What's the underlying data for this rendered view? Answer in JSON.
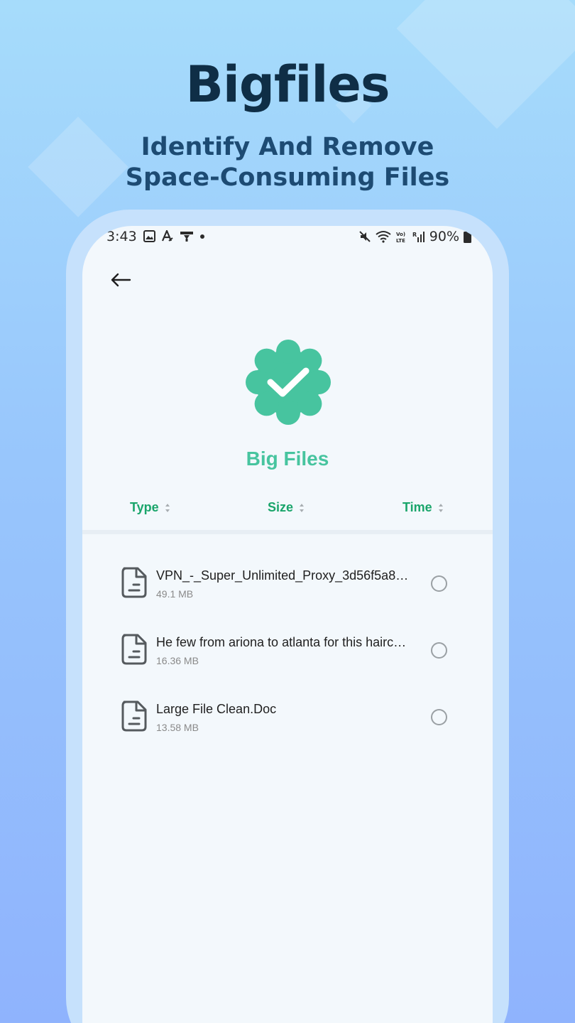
{
  "promo": {
    "headline": "Bigfiles",
    "subheadline": "Identify And Remove Space-Consuming Files"
  },
  "status_bar": {
    "time": "3:43",
    "battery": "90%",
    "icons_left": [
      "image-icon",
      "font-icon",
      "download-icon",
      "dot-icon"
    ],
    "icons_right": [
      "mute-icon",
      "wifi-icon",
      "volte-icon",
      "signal-icon",
      "battery-icon"
    ]
  },
  "screen": {
    "title": "Big Files",
    "accent_color": "#47c49f",
    "sort_color": "#1aa56b"
  },
  "sort": {
    "type": "Type",
    "size": "Size",
    "time": "Time"
  },
  "files": [
    {
      "name": "VPN_-_Super_Unlimited_Proxy_3d56f5a8.x…",
      "size": "49.1 MB",
      "selected": false
    },
    {
      "name": "He few from ariona to atlanta for this hairc…",
      "size": "16.36 MB",
      "selected": false
    },
    {
      "name": "Large File Clean.Doc",
      "size": "13.58 MB",
      "selected": false
    }
  ]
}
